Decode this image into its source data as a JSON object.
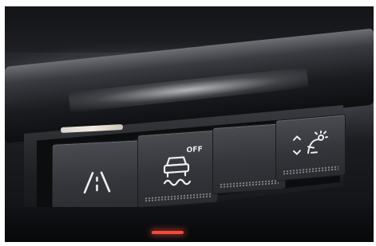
{
  "buttons": [
    {
      "name": "lane-keep-assist",
      "icon": "lane-departure-icon"
    },
    {
      "name": "traction-control-off",
      "icon": "skidding-car-icon",
      "label": "OFF"
    },
    {
      "name": "blank-switch",
      "icon": ""
    },
    {
      "name": "headlamp-leveling",
      "icon": "headlamp-adjust-icon"
    }
  ],
  "indicator_color": "#f1ece0",
  "led_color": "#f24a3b"
}
